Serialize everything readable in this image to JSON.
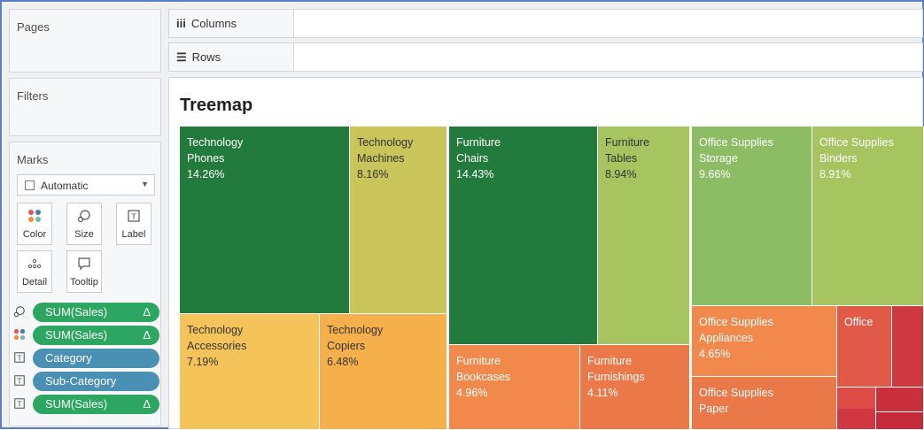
{
  "left_panel": {
    "pages_title": "Pages",
    "filters_title": "Filters",
    "marks": {
      "title": "Marks",
      "mark_type": "Automatic",
      "buttons": {
        "color": "Color",
        "size": "Size",
        "label": "Label",
        "detail": "Detail",
        "tooltip": "Tooltip"
      },
      "pills": [
        {
          "icon": "size-icon",
          "text": "SUM(Sales)",
          "delta": "Δ",
          "color": "#2ca661"
        },
        {
          "icon": "color-icon",
          "text": "SUM(Sales)",
          "delta": "Δ",
          "color": "#2ca661"
        },
        {
          "icon": "label-icon",
          "text": "Category",
          "delta": "",
          "color": "#4a8fb4"
        },
        {
          "icon": "label-icon",
          "text": "Sub-Category",
          "delta": "",
          "color": "#4a8fb4"
        },
        {
          "icon": "label-icon",
          "text": "SUM(Sales)",
          "delta": "Δ",
          "color": "#2ca661"
        }
      ]
    }
  },
  "shelves": {
    "columns_label": "Columns",
    "rows_label": "Rows"
  },
  "viz": {
    "title": "Treemap"
  },
  "chart_data": {
    "type": "treemap",
    "title": "Treemap",
    "tiles": [
      {
        "category": "Technology",
        "subcategory": "Phones",
        "value": "14.26%",
        "color": "#237a3d"
      },
      {
        "category": "Technology",
        "subcategory": "Machines",
        "value": "8.16%",
        "color": "#c9c55a"
      },
      {
        "category": "Technology",
        "subcategory": "Accessories",
        "value": "7.19%",
        "color": "#f4c45a"
      },
      {
        "category": "Technology",
        "subcategory": "Copiers",
        "value": "6.48%",
        "color": "#f5b04b"
      },
      {
        "category": "Furniture",
        "subcategory": "Chairs",
        "value": "14.43%",
        "color": "#237a3d"
      },
      {
        "category": "Furniture",
        "subcategory": "Tables",
        "value": "8.94%",
        "color": "#a6c45f"
      },
      {
        "category": "Furniture",
        "subcategory": "Bookcases",
        "value": "4.96%",
        "color": "#f0894b"
      },
      {
        "category": "Furniture",
        "subcategory": "Furnishings",
        "value": "4.11%",
        "color": "#ea7848"
      },
      {
        "category": "Office Supplies",
        "subcategory": "Storage",
        "value": "9.66%",
        "color": "#8cbd64"
      },
      {
        "category": "Office Supplies",
        "subcategory": "Binders",
        "value": "8.91%",
        "color": "#a6c45f"
      },
      {
        "category": "Office Supplies",
        "subcategory": "Appliances",
        "value": "4.65%",
        "color": "#f0894b"
      },
      {
        "category": "Office Supplies",
        "subcategory": "Paper",
        "value": "",
        "color": "#ea7848"
      },
      {
        "category": "Office",
        "subcategory": "",
        "value": "",
        "color": "#e05a47"
      },
      {
        "category": "",
        "subcategory": "",
        "value": "",
        "color": "#d0383f"
      },
      {
        "category": "",
        "subcategory": "",
        "value": "",
        "color": "#de4a44"
      },
      {
        "category": "",
        "subcategory": "",
        "value": "",
        "color": "#c9303b"
      },
      {
        "category": "",
        "subcategory": "",
        "value": "",
        "color": "#cf3840"
      },
      {
        "category": "",
        "subcategory": "",
        "value": "",
        "color": "#c52a38"
      }
    ]
  }
}
